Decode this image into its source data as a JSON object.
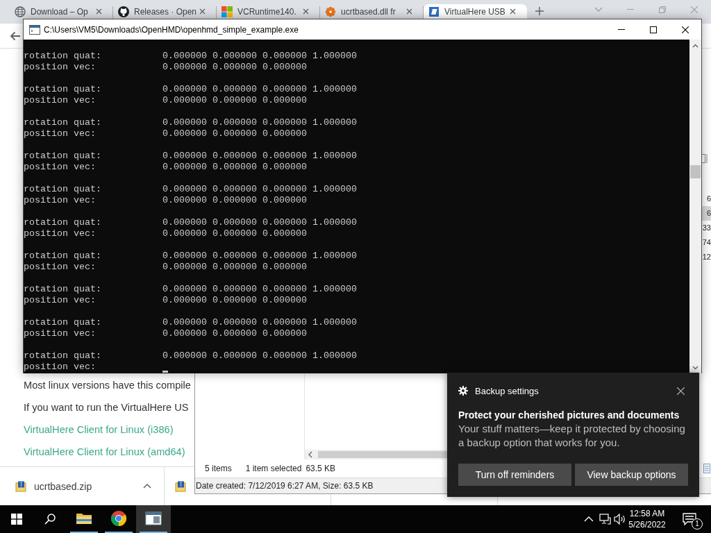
{
  "browser": {
    "tabs": [
      {
        "title": "Download – Op",
        "selected": false
      },
      {
        "title": "Releases · Open",
        "selected": false
      },
      {
        "title": "VCRuntime140.",
        "selected": false
      },
      {
        "title": "ucrtbased.dll fr",
        "selected": false
      },
      {
        "title": "VirtualHere USB",
        "selected": true
      }
    ],
    "page": {
      "texts": [
        {
          "kind": "paragraph",
          "text": "Most linux versions have this compile"
        },
        {
          "kind": "paragraph",
          "text": "If you want to run the VirtualHere US"
        },
        {
          "kind": "link",
          "text": "VirtualHere Client for Linux (i386)"
        },
        {
          "kind": "link",
          "text": "VirtualHere Client for Linux (amd64)"
        }
      ]
    },
    "downloads": [
      {
        "filename": "ucrtbased.zip"
      }
    ]
  },
  "console": {
    "title": "C:\\Users\\VM5\\Downloads\\OpenHMD\\openhmd_simple_example.exe",
    "cursor": true,
    "blocks": [
      {
        "lines": [
          {
            "label": "rotation quat:",
            "values": "0.000000 0.000000 0.000000 1.000000"
          },
          {
            "label": "position vec:",
            "values": "0.000000 0.000000 0.000000"
          }
        ]
      },
      {
        "lines": [
          {
            "label": "rotation quat:",
            "values": "0.000000 0.000000 0.000000 1.000000"
          },
          {
            "label": "position vec:",
            "values": "0.000000 0.000000 0.000000"
          }
        ]
      },
      {
        "lines": [
          {
            "label": "rotation quat:",
            "values": "0.000000 0.000000 0.000000 1.000000"
          },
          {
            "label": "position vec:",
            "values": "0.000000 0.000000 0.000000"
          }
        ]
      },
      {
        "lines": [
          {
            "label": "rotation quat:",
            "values": "0.000000 0.000000 0.000000 1.000000"
          },
          {
            "label": "position vec:",
            "values": "0.000000 0.000000 0.000000"
          }
        ]
      },
      {
        "lines": [
          {
            "label": "rotation quat:",
            "values": "0.000000 0.000000 0.000000 1.000000"
          },
          {
            "label": "position vec:",
            "values": "0.000000 0.000000 0.000000"
          }
        ]
      },
      {
        "lines": [
          {
            "label": "rotation quat:",
            "values": "0.000000 0.000000 0.000000 1.000000"
          },
          {
            "label": "position vec:",
            "values": "0.000000 0.000000 0.000000"
          }
        ]
      },
      {
        "lines": [
          {
            "label": "rotation quat:",
            "values": "0.000000 0.000000 0.000000 1.000000"
          },
          {
            "label": "position vec:",
            "values": "0.000000 0.000000 0.000000"
          }
        ]
      },
      {
        "lines": [
          {
            "label": "rotation quat:",
            "values": "0.000000 0.000000 0.000000 1.000000"
          },
          {
            "label": "position vec:",
            "values": "0.000000 0.000000 0.000000"
          }
        ]
      },
      {
        "lines": [
          {
            "label": "rotation quat:",
            "values": "0.000000 0.000000 0.000000 1.000000"
          },
          {
            "label": "position vec:",
            "values": "0.000000 0.000000 0.000000"
          }
        ]
      },
      {
        "lines": [
          {
            "label": "rotation quat:",
            "values": "0.000000 0.000000 0.000000 1.000000"
          },
          {
            "label": "position vec:"
          }
        ]
      }
    ]
  },
  "explorer": {
    "rows": [
      {
        "column_1": "6",
        "selected": false
      },
      {
        "column_1": "6",
        "selected": true
      },
      {
        "column_1": "33",
        "selected": false
      },
      {
        "column_1": "74",
        "selected": false
      },
      {
        "column_1": "12",
        "selected": false
      }
    ],
    "status": {
      "item_count": "5 items",
      "selection": "1 item selected",
      "selection_size": "63.5 KB"
    },
    "details": "Date created: 7/12/2019 6:27 AM, Size: 63.5 KB"
  },
  "notification": {
    "app": "Backup settings",
    "title": "Protect your cherished pictures and documents",
    "body": "Your stuff matters—keep it protected by choosing a backup option that works for you.",
    "buttons": [
      "Turn off reminders",
      "View backup options"
    ]
  },
  "taskbar": {
    "apps": [
      {
        "running": true,
        "selected": false
      },
      {
        "running": true,
        "selected": false
      },
      {
        "running": true,
        "selected": true
      }
    ],
    "time": "12:58 AM",
    "date": "5/26/2022",
    "notification_count": "1"
  }
}
